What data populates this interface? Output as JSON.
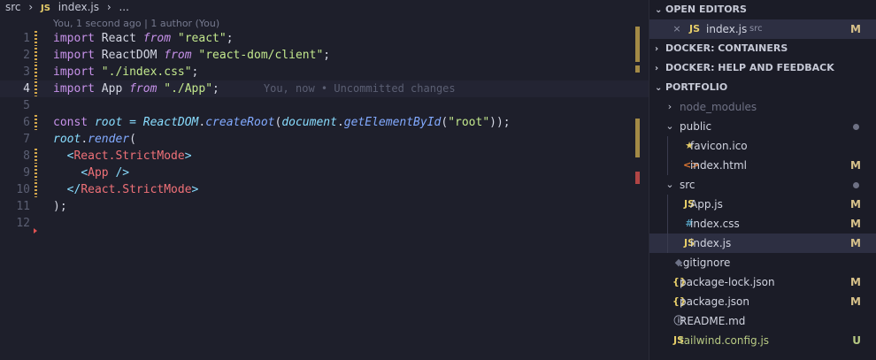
{
  "breadcrumb": {
    "folder": "src",
    "file_icon": "JS",
    "file": "index.js",
    "rest": "..."
  },
  "blame": "You, 1 second ago | 1 author (You)",
  "lines": [
    {
      "n": "1",
      "tokens": [
        [
          "kw",
          "import"
        ],
        [
          "p",
          " React "
        ],
        [
          "it",
          "from"
        ],
        [
          "p",
          " "
        ],
        [
          "str",
          "\"react\""
        ],
        [
          "p",
          ";"
        ]
      ]
    },
    {
      "n": "2",
      "tokens": [
        [
          "kw",
          "import"
        ],
        [
          "p",
          " ReactDOM "
        ],
        [
          "it",
          "from"
        ],
        [
          "p",
          " "
        ],
        [
          "str",
          "\"react-dom/client\""
        ],
        [
          "p",
          ";"
        ]
      ]
    },
    {
      "n": "3",
      "tokens": [
        [
          "kw",
          "import"
        ],
        [
          "p",
          " "
        ],
        [
          "str",
          "\"./index.css\""
        ],
        [
          "p",
          ";"
        ]
      ]
    },
    {
      "n": "4",
      "tokens": [
        [
          "kw",
          "import"
        ],
        [
          "p",
          " App "
        ],
        [
          "it",
          "from"
        ],
        [
          "p",
          " "
        ],
        [
          "str",
          "\"./App\""
        ],
        [
          "p",
          ";"
        ]
      ],
      "inline": "You, now • Uncommitted changes"
    },
    {
      "n": "5",
      "tokens": []
    },
    {
      "n": "6",
      "tokens": [
        [
          "kw",
          "const"
        ],
        [
          "p",
          " "
        ],
        [
          "var",
          "root"
        ],
        [
          "p",
          " "
        ],
        [
          "pun",
          "="
        ],
        [
          "p",
          " "
        ],
        [
          "cls",
          "ReactDOM"
        ],
        [
          "p",
          "."
        ],
        [
          "fn",
          "createRoot"
        ],
        [
          "p",
          "("
        ],
        [
          "var",
          "document"
        ],
        [
          "p",
          "."
        ],
        [
          "fn",
          "getElementById"
        ],
        [
          "p",
          "("
        ],
        [
          "str",
          "\"root\""
        ],
        [
          "p",
          "));"
        ]
      ]
    },
    {
      "n": "7",
      "tokens": [
        [
          "var",
          "root"
        ],
        [
          "p",
          "."
        ],
        [
          "fn",
          "render"
        ],
        [
          "p",
          "("
        ]
      ]
    },
    {
      "n": "8",
      "tokens": [
        [
          "p",
          "  "
        ],
        [
          "pun",
          "<"
        ],
        [
          "tag",
          "React.StrictMode"
        ],
        [
          "pun",
          ">"
        ]
      ]
    },
    {
      "n": "9",
      "tokens": [
        [
          "p",
          "    "
        ],
        [
          "pun",
          "<"
        ],
        [
          "tag",
          "App"
        ],
        [
          "p",
          " "
        ],
        [
          "pun",
          "/>"
        ]
      ]
    },
    {
      "n": "10",
      "tokens": [
        [
          "p",
          "  "
        ],
        [
          "pun",
          "</"
        ],
        [
          "tag",
          "React.StrictMode"
        ],
        [
          "pun",
          ">"
        ]
      ]
    },
    {
      "n": "11",
      "tokens": [
        [
          "p",
          ");"
        ]
      ]
    },
    {
      "n": "12",
      "tokens": []
    }
  ],
  "sidebar": {
    "open_editors": "OPEN EDITORS",
    "open_file": {
      "close_icon": "×",
      "file_icon": "JS",
      "name": "index.js",
      "folder": "src",
      "status": "M"
    },
    "docker_containers": "DOCKER: CONTAINERS",
    "docker_help": "DOCKER: HELP AND FEEDBACK",
    "portfolio": "PORTFOLIO",
    "tree": [
      {
        "name": "node_modules",
        "icon": "",
        "chevron": "›",
        "depth": 0,
        "dim": true,
        "status": ""
      },
      {
        "name": "public",
        "icon": "",
        "chevron": "⌄",
        "depth": 0,
        "status": "",
        "dot": true
      },
      {
        "name": "favicon.ico",
        "icon": "★",
        "iconColor": "#e6cd69",
        "depth": 1,
        "status": ""
      },
      {
        "name": "index.html",
        "icon": "<>",
        "iconColor": "#e37933",
        "depth": 1,
        "status": "M"
      },
      {
        "name": "src",
        "icon": "",
        "chevron": "⌄",
        "depth": 0,
        "status": "",
        "dot": true
      },
      {
        "name": "App.js",
        "icon": "JS",
        "iconColor": "#e6cd69",
        "depth": 1,
        "status": "M"
      },
      {
        "name": "index.css",
        "icon": "#",
        "iconColor": "#519aba",
        "depth": 1,
        "status": "M"
      },
      {
        "name": "index.js",
        "icon": "JS",
        "iconColor": "#e6cd69",
        "depth": 1,
        "status": "M",
        "selected": true
      },
      {
        "name": ".gitignore",
        "icon": "◆",
        "iconColor": "#6d7287",
        "depth": 0,
        "status": ""
      },
      {
        "name": "package-lock.json",
        "icon": "{}",
        "iconColor": "#e6cd69",
        "depth": 0,
        "status": "M"
      },
      {
        "name": "package.json",
        "icon": "{}",
        "iconColor": "#e6cd69",
        "depth": 0,
        "status": "M"
      },
      {
        "name": "README.md",
        "icon": "ⓘ",
        "iconColor": "#9fa3b5",
        "depth": 0,
        "status": ""
      },
      {
        "name": "tailwind.config.js",
        "icon": "JS",
        "iconColor": "#e6cd69",
        "depth": 0,
        "status": "U",
        "nameColor": "#b7c983"
      }
    ]
  }
}
